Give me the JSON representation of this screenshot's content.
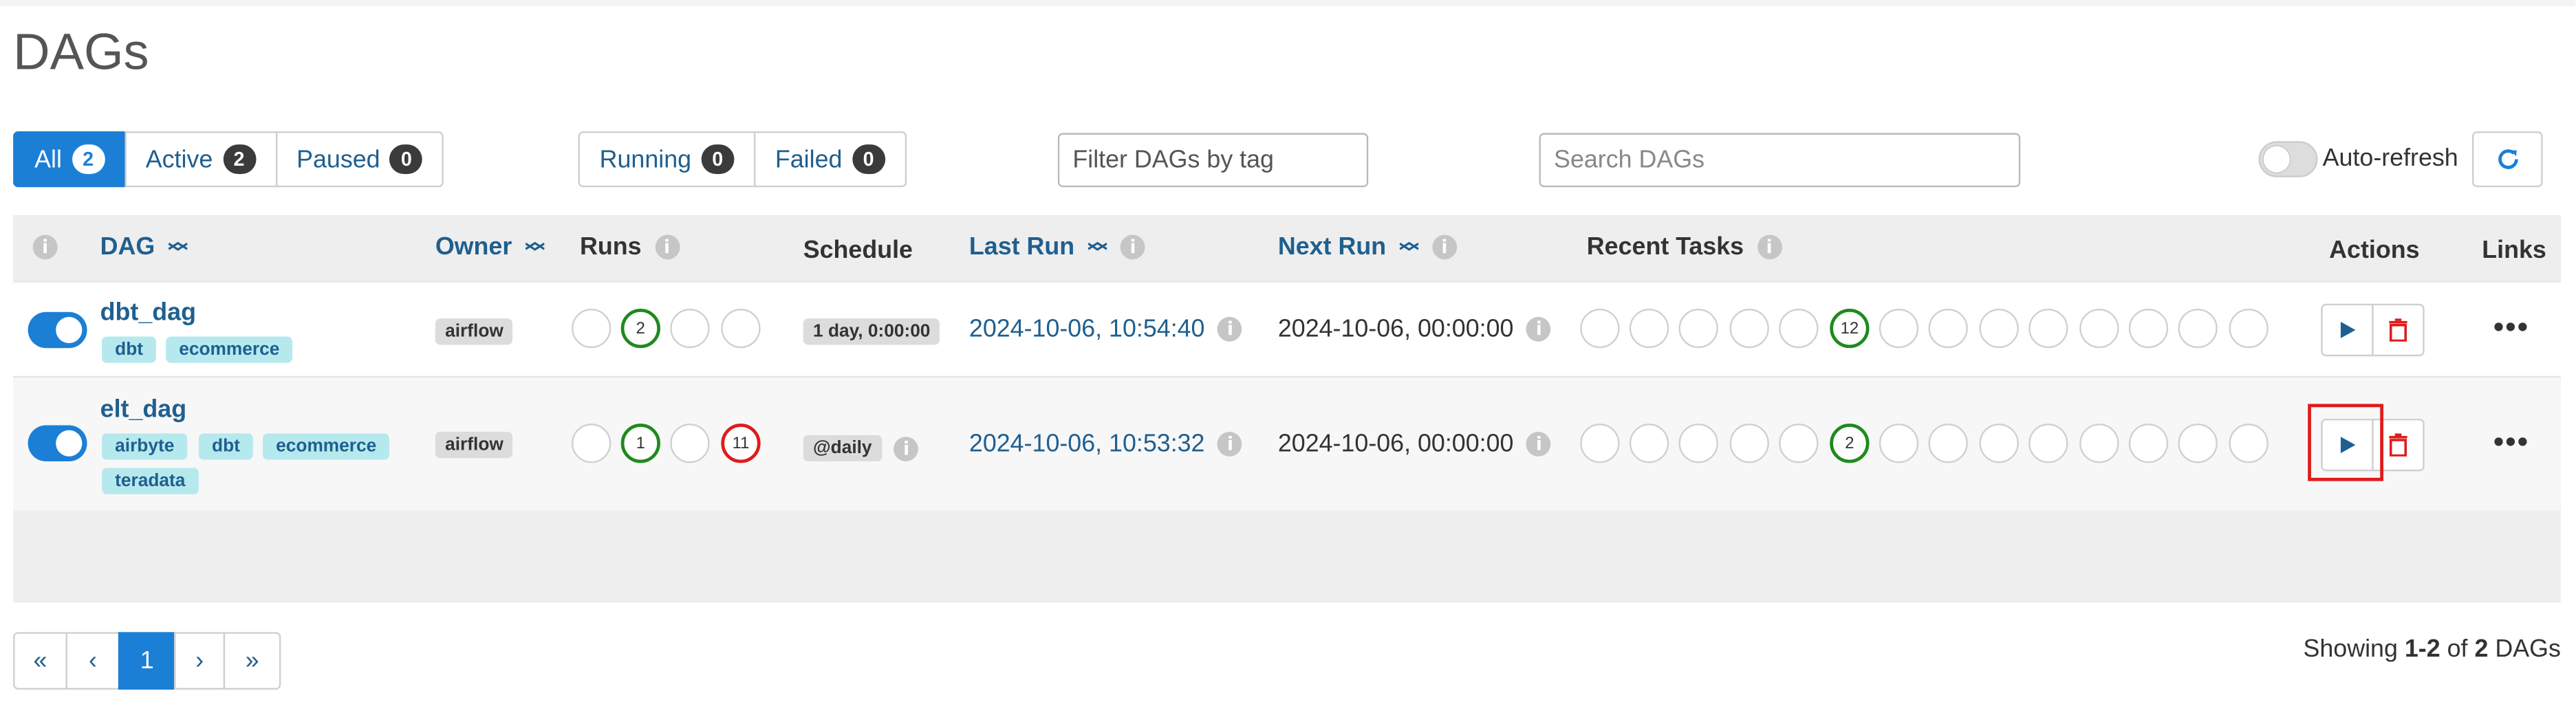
{
  "page": {
    "title": "DAGs"
  },
  "status_filters": [
    {
      "label": "All",
      "count": "2",
      "active": true
    },
    {
      "label": "Active",
      "count": "2",
      "active": false
    },
    {
      "label": "Paused",
      "count": "0",
      "active": false
    }
  ],
  "run_filters": [
    {
      "label": "Running",
      "count": "0"
    },
    {
      "label": "Failed",
      "count": "0"
    }
  ],
  "tag_filter": {
    "placeholder": "Filter DAGs by tag"
  },
  "search": {
    "placeholder": "Search DAGs"
  },
  "auto_refresh": {
    "label": "Auto-refresh",
    "enabled": false
  },
  "table": {
    "headers": {
      "info": "i",
      "dag": "DAG",
      "owner": "Owner",
      "runs": "Runs",
      "schedule": "Schedule",
      "last_run": "Last Run",
      "next_run": "Next Run",
      "recent_tasks": "Recent Tasks",
      "actions": "Actions",
      "links": "Links"
    },
    "rows": [
      {
        "dag_id": "dbt_dag",
        "tags": [
          "dbt",
          "ecommerce"
        ],
        "owner": "airflow",
        "runs": [
          "",
          "2",
          "",
          ""
        ],
        "schedule": "1 day, 0:00:00",
        "last_run": "2024-10-06, 10:54:40",
        "next_run": "2024-10-06, 00:00:00",
        "recent_tasks": [
          "",
          "",
          "",
          "",
          "",
          "12",
          "",
          "",
          "",
          "",
          "",
          "",
          "",
          ""
        ],
        "links_label": "•••"
      },
      {
        "dag_id": "elt_dag",
        "tags": [
          "airbyte",
          "dbt",
          "ecommerce",
          "teradata"
        ],
        "owner": "airflow",
        "runs": [
          "",
          "1",
          "",
          "11"
        ],
        "schedule": "@daily",
        "last_run": "2024-10-06, 10:53:32",
        "next_run": "2024-10-06, 00:00:00",
        "recent_tasks": [
          "",
          "",
          "",
          "",
          "",
          "2",
          "",
          "",
          "",
          "",
          "",
          "",
          "",
          ""
        ],
        "links_label": "•••"
      }
    ]
  },
  "pagination": {
    "first": "«",
    "prev": "‹",
    "current": "1",
    "next": "›",
    "last": "»"
  },
  "showing": {
    "prefix": "Showing ",
    "range": "1-2",
    "middle": " of ",
    "total": "2",
    "suffix": " DAGs"
  },
  "colors": {
    "accent": "#1c7fd6",
    "link": "#1f5f8f",
    "success": "#1e8a1e",
    "failed": "#e01b1b",
    "tag": "#b5e9ee"
  }
}
